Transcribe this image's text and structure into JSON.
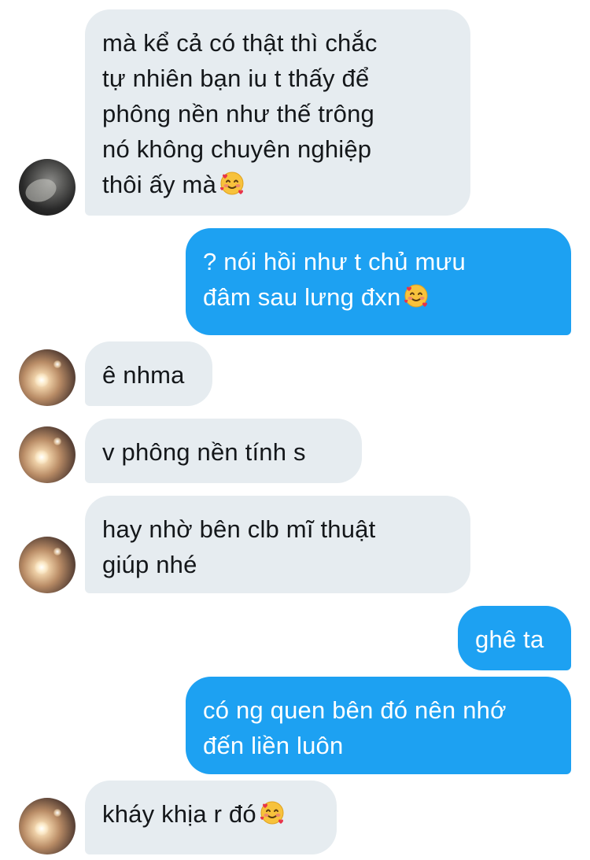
{
  "messages": [
    {
      "side": "incoming",
      "text": "mà kể cả có thật thì chắc\ntự nhiên bạn iu t thấy để\nphông nền như thế trông\nnó không chuyên nghiệp\nthôi ấy mà",
      "emoji": "smiling-face-with-hearts"
    },
    {
      "side": "outgoing",
      "text": "? nói hồi như t chủ mưu\nđâm sau lưng đxn",
      "emoji": "smiling-face-with-hearts"
    },
    {
      "side": "incoming",
      "text": "ê nhma"
    },
    {
      "side": "incoming",
      "text": "v phông nền tính s"
    },
    {
      "side": "incoming",
      "text": "hay nhờ bên clb mĩ thuật\ngiúp nhé"
    },
    {
      "side": "outgoing",
      "text": "ghê ta"
    },
    {
      "side": "outgoing",
      "text": "có ng quen bên đó nên nhớ\nđến liền luôn"
    },
    {
      "side": "incoming",
      "text": "kháy khịa r đó",
      "emoji": "smiling-face-with-hearts"
    }
  ],
  "colors": {
    "incoming_bubble": "#e6ecf0",
    "outgoing_bubble": "#1da1f2",
    "incoming_text": "#14171a",
    "outgoing_text": "#ffffff"
  }
}
